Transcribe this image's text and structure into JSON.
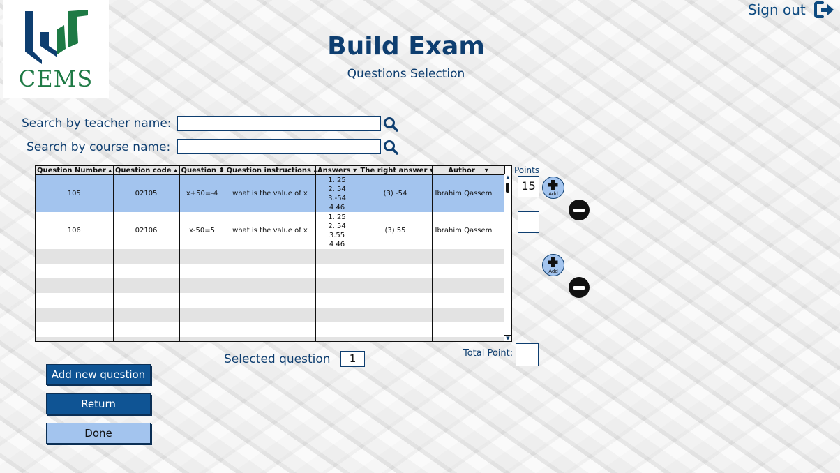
{
  "logo": {
    "text": "CEMS"
  },
  "header": {
    "sign_out_label": "Sign out",
    "title": "Build Exam",
    "subtitle": "Questions Selection"
  },
  "search": {
    "teacher_label": "Search by teacher name:",
    "teacher_value": "",
    "course_label": "Search by course name:",
    "course_value": ""
  },
  "table": {
    "columns": [
      "Question Number",
      "Question code",
      "Question",
      "Question instructions",
      "Answers",
      "The right answer",
      "Author"
    ],
    "rows": [
      {
        "number": "105",
        "code": "02105",
        "question": "x+50=-4",
        "instructions": "what is the value of x",
        "answers": [
          "1. 25",
          "2. 54",
          "3.-54",
          "4 46"
        ],
        "right_answer": "(3) -54",
        "author": "Ibrahim Qassem",
        "selected": true
      },
      {
        "number": "106",
        "code": "02106",
        "question": "x-50=5",
        "instructions": "what is the value of x",
        "answers": [
          "1. 25",
          "2. 54",
          "3.55",
          "4 46"
        ],
        "right_answer": "(3) 55",
        "author": "Ibrahim Qassem",
        "selected": false
      }
    ]
  },
  "points": {
    "label": "Points",
    "values": [
      "15",
      ""
    ],
    "add_label": "Add"
  },
  "footer": {
    "selected_label": "Selected question",
    "selected_value": "1",
    "total_label": "Total Point:",
    "total_value": ""
  },
  "buttons": {
    "add_new_question": "Add new question",
    "return": "Return",
    "done": "Done"
  },
  "colors": {
    "primary": "#0f5494",
    "light": "#a3c4ee",
    "text": "#0e3e70",
    "brand_green": "#1e7a45"
  }
}
